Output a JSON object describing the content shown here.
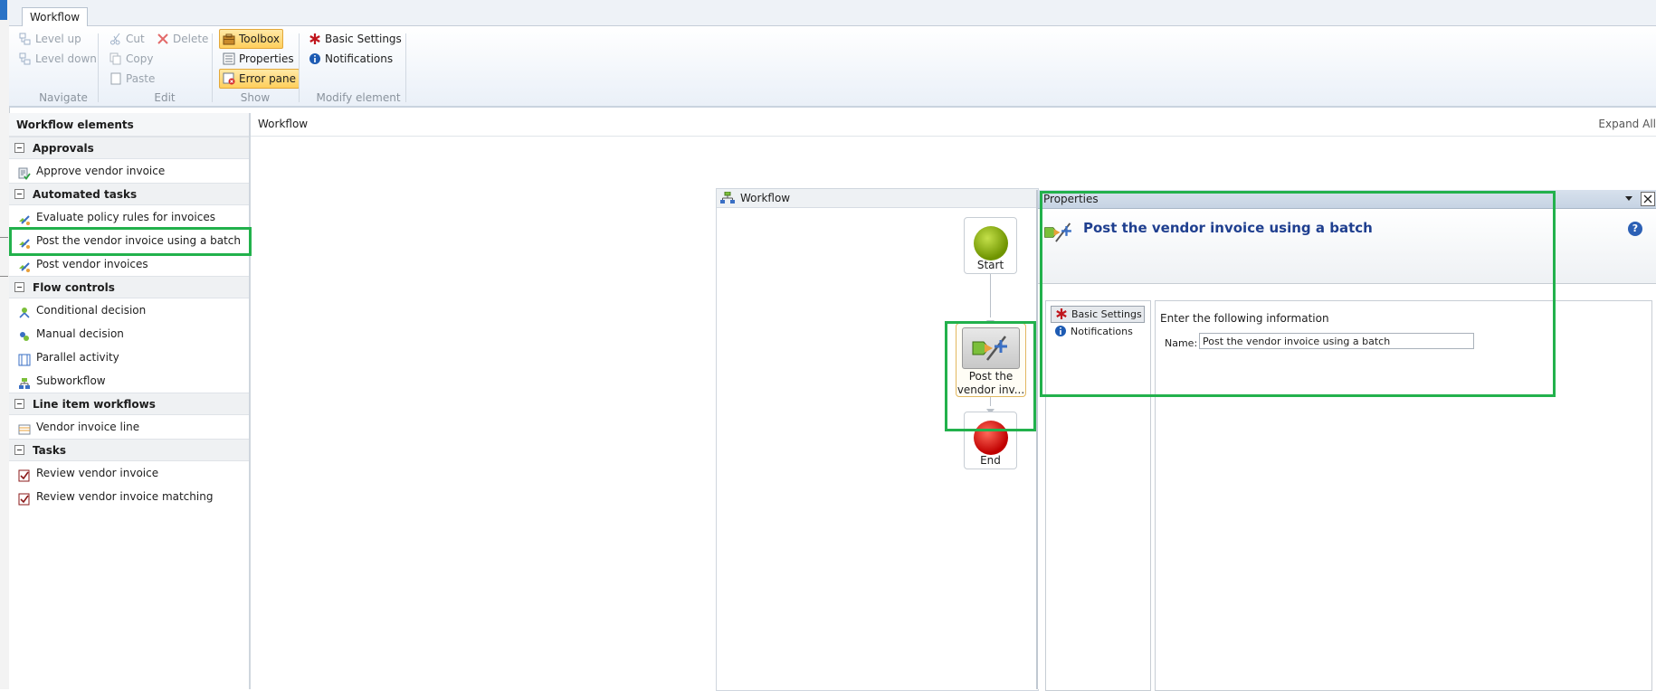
{
  "ribbon": {
    "tab": "Workflow",
    "navigate": {
      "level_up": "Level up",
      "level_down": "Level down",
      "label": "Navigate"
    },
    "edit": {
      "cut": "Cut",
      "delete": "Delete",
      "copy": "Copy",
      "paste": "Paste",
      "label": "Edit"
    },
    "show": {
      "toolbox": "Toolbox",
      "properties": "Properties",
      "error_pane": "Error pane",
      "label": "Show"
    },
    "modify": {
      "basic_settings": "Basic Settings",
      "notifications": "Notifications",
      "label": "Modify element"
    }
  },
  "toolbox": {
    "title": "Workflow elements",
    "categories": [
      {
        "name": "Approvals",
        "items": [
          "Approve vendor invoice"
        ]
      },
      {
        "name": "Automated tasks",
        "items": [
          "Evaluate policy rules for invoices",
          "Post the vendor invoice using a batch",
          "Post vendor invoices"
        ]
      },
      {
        "name": "Flow controls",
        "items": [
          "Conditional decision",
          "Manual decision",
          "Parallel activity",
          "Subworkflow"
        ]
      },
      {
        "name": "Line item workflows",
        "items": [
          "Vendor invoice line"
        ]
      },
      {
        "name": "Tasks",
        "items": [
          "Review vendor invoice",
          "Review vendor invoice matching"
        ]
      }
    ]
  },
  "canvas": {
    "title": "Workflow",
    "expand_all": "Expand All",
    "diagram_title": "Workflow",
    "nodes": {
      "start": "Start",
      "task_line1": "Post the",
      "task_line2": "vendor inv...",
      "end": "End"
    }
  },
  "properties": {
    "title": "Properties",
    "caption": "Post the vendor invoice using a batch",
    "nav": {
      "basic_settings": "Basic Settings",
      "notifications": "Notifications"
    },
    "instructions": "Enter the following information",
    "name_label": "Name:",
    "name_value": "Post the vendor invoice using a batch"
  },
  "colors": {
    "highlight": "#22b14c",
    "accent": "#1f3f8f",
    "start": "#8cb000",
    "end": "#e00000"
  }
}
